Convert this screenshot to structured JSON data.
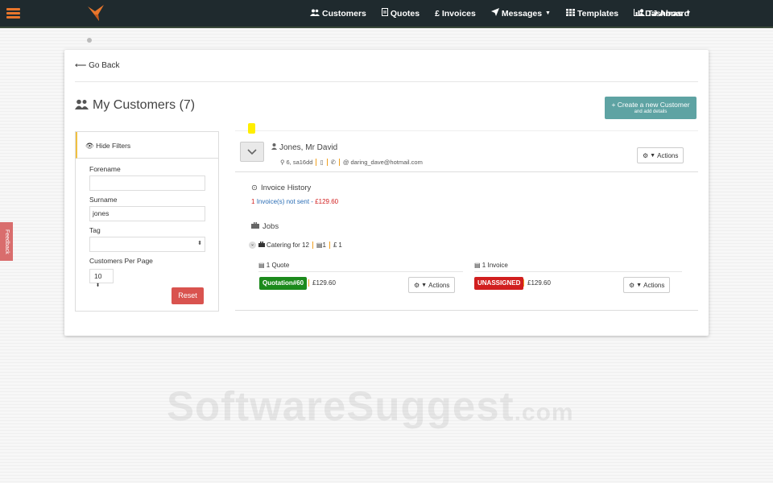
{
  "navbar": {
    "items": [
      {
        "icon": "users-icon",
        "label": "Customers"
      },
      {
        "icon": "document-icon",
        "label": "Quotes"
      },
      {
        "icon": "pound-icon",
        "label": "£ Invoices"
      },
      {
        "icon": "paper-plane-icon",
        "label": "Messages"
      },
      {
        "icon": "templates-icon",
        "label": "Templates"
      },
      {
        "icon": "chart-icon",
        "label": "Dashboard"
      }
    ],
    "user": "TJ Amas"
  },
  "page": {
    "go_back": "Go Back",
    "title": "My Customers (7)",
    "create_button_line1": "Create a new Customer",
    "create_button_line2": "and add details"
  },
  "filters": {
    "toggle_label": "Hide Filters",
    "forename_label": "Forename",
    "forename_value": "",
    "surname_label": "Surname",
    "surname_value": "jones",
    "tag_label": "Tag",
    "tag_value": "",
    "per_page_label": "Customers Per Page",
    "per_page_value": "10",
    "reset_label": "Reset"
  },
  "customer": {
    "name": "Jones, Mr David",
    "address": "6, sa16dd",
    "email": "daring_dave@hotmail.com",
    "actions_label": "Actions",
    "invoice_history_title": "Invoice History",
    "invoice_count": "1",
    "invoice_text": "Invoice(s) not sent",
    "invoice_separator": "-",
    "invoice_amount": "£129.60",
    "jobs_title": "Jobs",
    "job": {
      "name": "Catering for 12",
      "doc_count": "1",
      "pound_count": "1",
      "quote_col_title": "1 Quote",
      "invoice_col_title": "1 Invoice",
      "quote_badge": "Quotation#60",
      "quote_amount": "£129.60",
      "invoice_badge": "UNASSIGNED",
      "invoice_amount": "£129.60",
      "actions_label": "Actions"
    }
  },
  "feedback_label": "Feedback",
  "watermark": {
    "main": "SoftwareSuggest",
    "suffix": ".com"
  },
  "colors": {
    "navbar_bg": "#1f2a2e",
    "accent_orange": "#e8762c",
    "create_button": "#5ea3a3",
    "reset_button": "#d9534f",
    "quote_badge": "#1c8a1c",
    "unassigned_badge": "#d11f1f",
    "link_blue": "#2a6db5",
    "amount_red": "#d11f1f"
  }
}
